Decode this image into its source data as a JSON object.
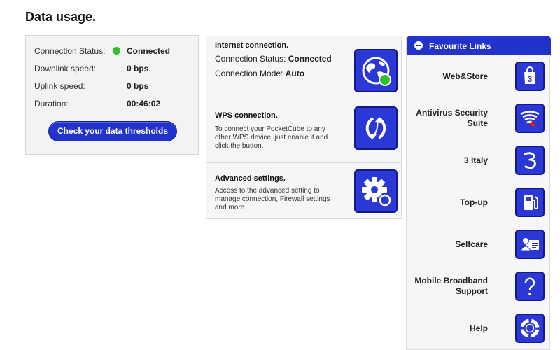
{
  "page": {
    "title": "Data usage."
  },
  "status": {
    "connection_label": "Connection Status:",
    "connection_value": "Connected",
    "connection_color": "#2ec12e",
    "downlink_label": "Downlink speed:",
    "downlink_value": "0 bps",
    "uplink_label": "Uplink speed:",
    "uplink_value": "0 bps",
    "duration_label": "Duration:",
    "duration_value": "00:46:02",
    "button_label": "Check your data thresholds"
  },
  "internet": {
    "title": "Internet connection.",
    "status_label": "Connection Status:",
    "status_value": "Connected",
    "mode_label": "Connection Mode:",
    "mode_value": "Auto",
    "icon": "globe-icon"
  },
  "wps": {
    "title": "WPS connection.",
    "description": "To connect your PocketCube to any other WPS device, just enable it and click the button.",
    "icon": "wps-icon"
  },
  "advanced": {
    "title": "Advanced settings.",
    "description": "Access to the advanced setting to manage connection, Firewall settings and more…",
    "icon": "gear-icon"
  },
  "favourites": {
    "title": "Favourite Links",
    "items": [
      {
        "label": "Web&Store",
        "icon": "store-icon"
      },
      {
        "label": "Antivirus Security Suite",
        "icon": "antivirus-icon"
      },
      {
        "label": "3 Italy",
        "icon": "three-logo-icon"
      },
      {
        "label": "Top-up",
        "icon": "top-up-icon"
      },
      {
        "label": "Selfcare",
        "icon": "selfcare-icon"
      },
      {
        "label": "Mobile Broadband Support",
        "icon": "help-question-icon"
      },
      {
        "label": "Help",
        "icon": "lifebuoy-icon"
      }
    ]
  },
  "colors": {
    "accent": "#2233cc",
    "tile": "#2b38d6",
    "online": "#2ec12e"
  }
}
